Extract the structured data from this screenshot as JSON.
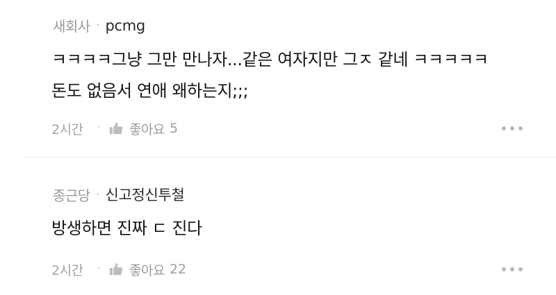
{
  "comments": [
    {
      "board": "새회사",
      "separator": "·",
      "nickname": "pcmg",
      "lines": [
        "ㅋㅋㅋㅋ그냥 그만 만나자...같은 여자지만 그ㅈ 같네 ㅋㅋㅋㅋㅋ",
        "돈도 없음서 연애 왜하는지;;;"
      ],
      "time": "2시간",
      "time_separator": "·",
      "like_label": "좋아요",
      "like_count": "5",
      "icons": {
        "like": "thumbs-up-icon",
        "more": "more-dots-icon"
      }
    },
    {
      "board": "종근당",
      "separator": "·",
      "nickname": "신고정신투철",
      "lines": [
        "방생하면 진짜 ㄷ 진다"
      ],
      "time": "2시간",
      "time_separator": "·",
      "like_label": "좋아요",
      "like_count": "22",
      "icons": {
        "like": "thumbs-up-icon",
        "more": "more-dots-icon"
      }
    }
  ],
  "colors": {
    "meta_gray": "#9a9a9a",
    "text": "#151515",
    "icon_gray": "#b9b9b9",
    "divider": "#ececec"
  }
}
